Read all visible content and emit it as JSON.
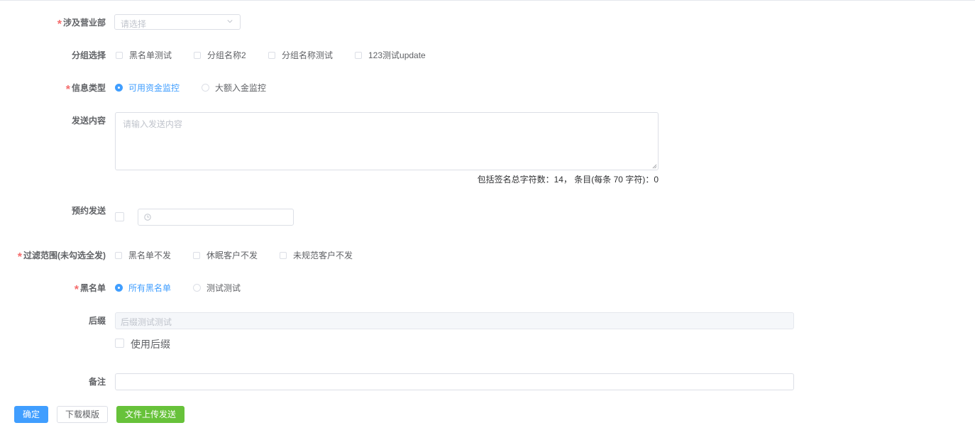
{
  "form": {
    "department": {
      "label": "涉及营业部",
      "placeholder": "请选择",
      "required": true
    },
    "group": {
      "label": "分组选择",
      "options": [
        "黑名单测试",
        "分组名称2",
        "分组名称测试",
        "123测试update"
      ]
    },
    "info_type": {
      "label": "信息类型",
      "required": true,
      "options": [
        "可用资金监控",
        "大额入金监控"
      ],
      "selected": "可用资金监控"
    },
    "content": {
      "label": "发送内容",
      "placeholder": "请输入发送内容",
      "counter": "包括签名总字符数：14， 条目(每条 70 字符)：0"
    },
    "schedule": {
      "label": "预约发送"
    },
    "filter": {
      "label": "过滤范围(未勾选全发)",
      "required": true,
      "options": [
        "黑名单不发",
        "休眠客户不发",
        "未规范客户不发"
      ]
    },
    "blacklist": {
      "label": "黑名单",
      "required": true,
      "options": [
        "所有黑名单",
        "测试测试"
      ],
      "selected": "所有黑名单"
    },
    "suffix": {
      "label": "后缀",
      "value": "后缀测试测试",
      "use_label": "使用后缀"
    },
    "remark": {
      "label": "备注",
      "value": ""
    }
  },
  "buttons": {
    "confirm": "确定",
    "download_template": "下载模版",
    "upload_send": "文件上传发送"
  },
  "colors": {
    "primary": "#409eff",
    "success": "#67c23a",
    "required": "#f56c6c"
  },
  "icons": {
    "select_arrow": "chevron-down-icon",
    "time": "clock-icon",
    "resize": "resize-grip-icon"
  }
}
